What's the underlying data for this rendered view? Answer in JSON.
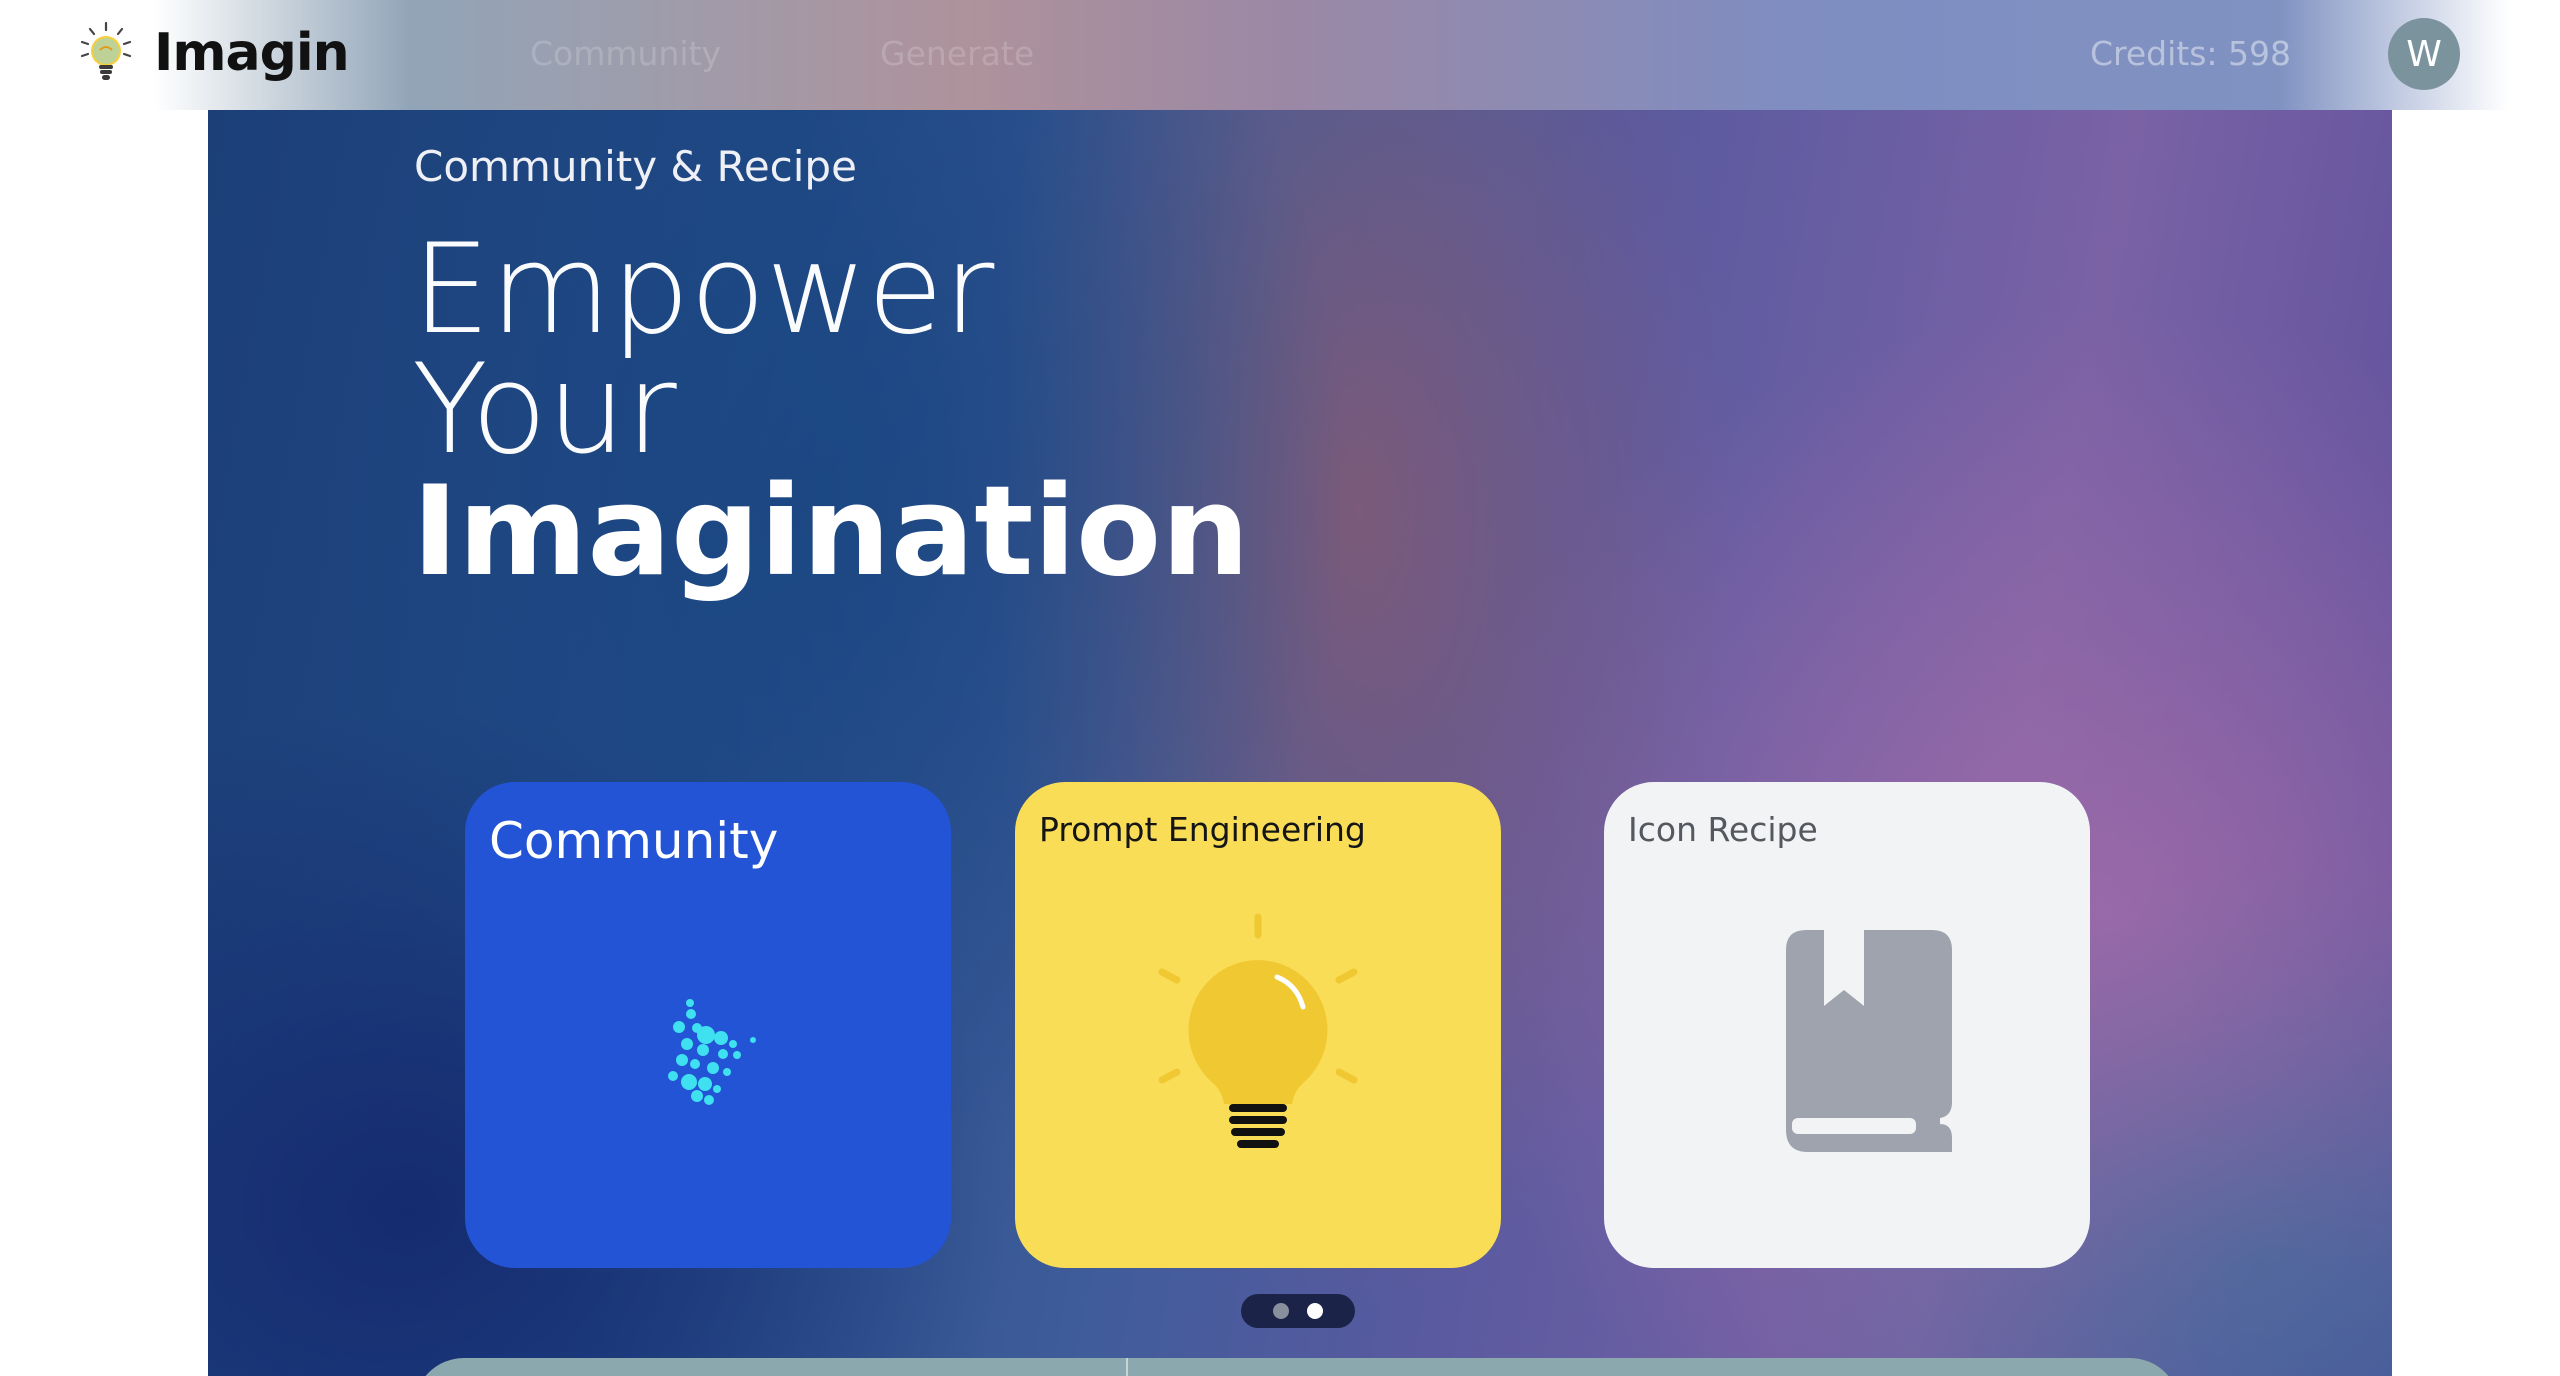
{
  "app": {
    "name": "Imagin",
    "logo_icon": "lightbulb-icon"
  },
  "nav": {
    "items": [
      {
        "label": "Community"
      },
      {
        "label": "Generate"
      }
    ]
  },
  "account": {
    "credits_label": "Credits: 598",
    "avatar_initial": "W"
  },
  "hero": {
    "subtitle": "Community & Recipe",
    "title_line1": "Empower",
    "title_line2": "Your",
    "title_line3": "Imagination"
  },
  "cards": [
    {
      "title": "Community",
      "icon": "particles-icon",
      "color": "#2354d6"
    },
    {
      "title": "Prompt Engineering",
      "icon": "lightbulb-icon",
      "color": "#fadd56"
    },
    {
      "title": "Icon Recipe",
      "icon": "book-bookmark-icon",
      "color": "#f2f3f5"
    }
  ],
  "pager": {
    "pages": 2,
    "active": 2
  },
  "colors": {
    "accent_blue": "#2354d6",
    "accent_yellow": "#fadd56",
    "card_gray": "#f2f3f5",
    "avatar_bg": "#7a939c"
  }
}
